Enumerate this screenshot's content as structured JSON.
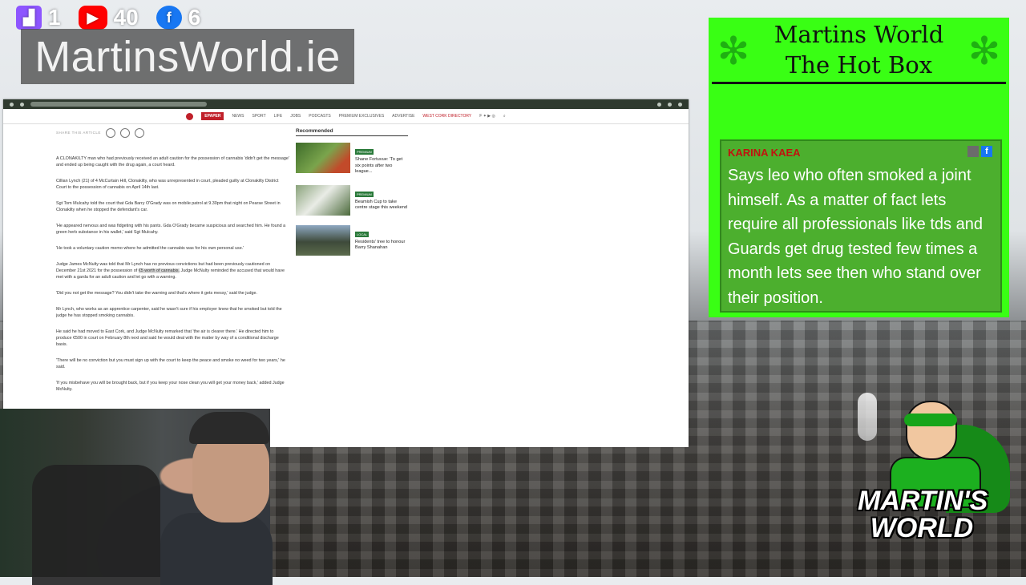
{
  "social": {
    "twitch": {
      "icon": "twitch-icon",
      "count": "1"
    },
    "youtube": {
      "icon": "youtube-icon",
      "count": "40"
    },
    "facebook": {
      "icon": "facebook-icon",
      "count": "6"
    }
  },
  "brand": {
    "site": "MartinsWorld.ie"
  },
  "browser": {
    "nav": {
      "epaper": "EPAPER",
      "items": [
        "NEWS",
        "SPORT",
        "LIFE",
        "JOBS",
        "PODCASTS",
        "PREMIUM EXCLUSIVES",
        "ADVERTISE"
      ],
      "highlight": "WEST CORK DIRECTORY"
    },
    "article": {
      "share_label": "SHARE THIS ARTICLE",
      "p1": "A CLONAKILTY man who had previously received an adult caution for the possession of cannabis 'didn't get the message' and ended up being caught with the drug again, a court heard.",
      "p2": "Cillian Lynch (21) of 4 McCurtain Hill, Clonakilty, who was unrepresented in court, pleaded guilty at Clonakilty District Court to the possession of cannabis on April 14th last.",
      "p3": "Sgt Tom Mulcahy told the court that Gda Barry O'Grady was on mobile patrol at 9.30pm that night on Pearse Street in Clonakilty when he stopped the defendant's car.",
      "p4": "'He appeared nervous and was fidgeting with his pants. Gda O'Grady became suspicious and searched him. He found a green herb substance in his wallet,' said Sgt Mulcahy.",
      "p5": "'He took a voluntary caution memo where he admitted the cannabis was for his own personal use.'",
      "p6a": "Judge James McNulty was told that Mr Lynch has no previous convictions but had been previously cautioned on December 21st 2021 for the possession of ",
      "p6b": "€5 worth of cannabis.",
      "p6c": " Judge McNulty reminded the accused that would have met with a garda for an adult caution and let go with a warning.",
      "p7": "'Did you not get the message? You didn't take the warning and that's where it gets messy,' said the judge.",
      "p8": "Mr Lynch, who works as an apprentice carpenter, said he wasn't sure if his employer knew that he smoked but told the judge he has stopped smoking cannabis.",
      "p9": "He said he had moved to East Cork, and Judge McNulty remarked that 'the air is clearer there.' He directed him to produce €500 in court on February 8th next and said he would deal with the matter by way of a conditional discharge basis.",
      "p10": "'There will be no conviction but you must sign up with the court to keep the peace and smoke no weed for two years,' he said.",
      "p11": "'If you misbehave you will be brought back, but if you keep your nose clean you will get your money back,' added Judge McNulty."
    },
    "recommended": {
      "title": "Recommended",
      "items": [
        {
          "tag": "PREMIUM",
          "text": "Shane Fortuvue: 'To get six points after two league..."
        },
        {
          "tag": "PREMIUM",
          "text": "Beamish Cup to take centre stage this weekend"
        },
        {
          "tag": "LOCAL",
          "text": "Residents' tree to honour Barry Shanahan"
        }
      ]
    }
  },
  "hotbox": {
    "title_line1": "Martins World",
    "title_line2": "The Hot Box",
    "chat": {
      "name": "KARINA KAEA",
      "message": "Says leo who often smoked a joint himself. As a matter of fact lets require all professionals like tds and Guards get drug tested few times a month lets see then who stand over their position."
    }
  },
  "mascot": {
    "logo_line1": "MARTIN'S",
    "logo_line2": "WORLD"
  }
}
